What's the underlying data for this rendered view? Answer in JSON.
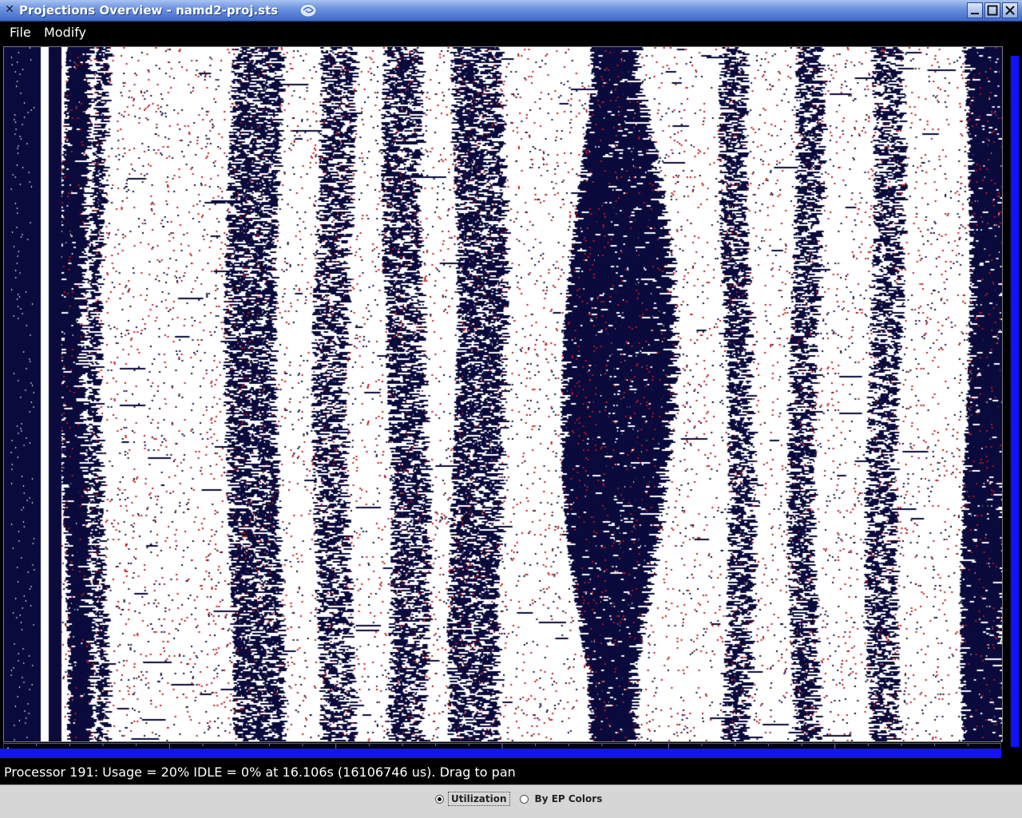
{
  "window": {
    "title": "Projections Overview - namd2-proj.sts",
    "app_icon": "x-close-glyph-icon",
    "controls": [
      "minimize",
      "maximize",
      "close"
    ]
  },
  "menubar": {
    "items": [
      "File",
      "Modify"
    ]
  },
  "plot": {
    "colors": {
      "busy": "#0a0a3c",
      "idle": "#ffffff",
      "overhead": "#c01616",
      "scroll": "#1414f0"
    }
  },
  "status": {
    "text": "Processor 191: Usage = 20% IDLE = 0% at 16.106s (16106746 us).  Drag to pan"
  },
  "color_mode": {
    "options": [
      "Utilization",
      "By EP Colors"
    ],
    "selected": "Utilization"
  }
}
